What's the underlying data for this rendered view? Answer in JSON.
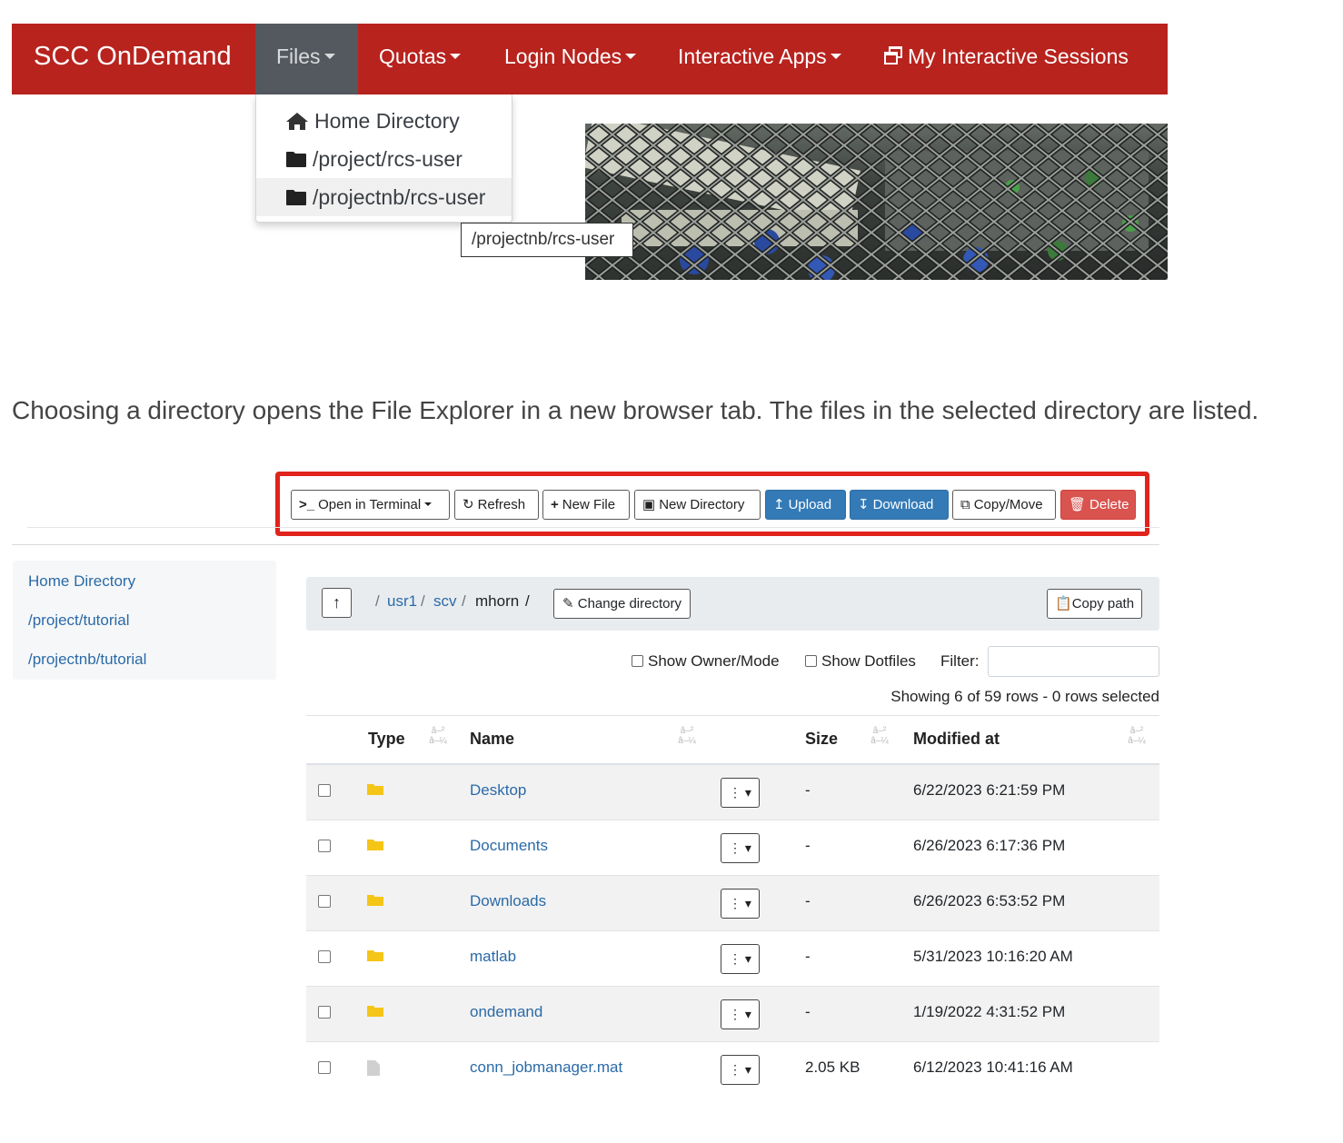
{
  "navbar": {
    "brand": "SCC OnDemand",
    "items": [
      {
        "label": "Files",
        "active": true
      },
      {
        "label": "Quotas"
      },
      {
        "label": "Login Nodes"
      },
      {
        "label": "Interactive Apps"
      },
      {
        "label": "My Interactive Sessions"
      }
    ],
    "files_menu": [
      {
        "label": "Home Directory",
        "icon": "home-icon"
      },
      {
        "label": "/project/rcs-user",
        "icon": "folder-icon"
      },
      {
        "label": "/projectnb/rcs-user",
        "icon": "folder-icon"
      }
    ],
    "tooltip": "/projectnb/rcs-user",
    "colors": {
      "bar": "#b8231e",
      "active": "#54595f"
    }
  },
  "caption": "Choosing a directory opens the File Explorer in a new browser tab. The files in the selected directory are listed.",
  "toolbar": {
    "open_terminal": "Open in Terminal",
    "refresh": "Refresh",
    "new_file": "New File",
    "new_directory": "New Directory",
    "upload": "Upload",
    "download": "Download",
    "copy_move": "Copy/Move",
    "delete": "Delete"
  },
  "favorites": [
    "Home Directory",
    "/project/tutorial",
    "/projectnb/tutorial"
  ],
  "path": {
    "segments": [
      "/",
      "usr1",
      "/",
      "scv",
      "/",
      "mhorn",
      "/"
    ],
    "change_directory": "Change directory",
    "copy_path": "Copy path"
  },
  "options": {
    "show_owner_mode": "Show Owner/Mode",
    "show_dotfiles": "Show Dotfiles",
    "filter_label": "Filter:",
    "row_info": "Showing 6 of 59 rows - 0 rows selected"
  },
  "table": {
    "headers": {
      "type": "Type",
      "name": "Name",
      "size": "Size",
      "modified": "Modified at"
    },
    "sort_glyph_top": "â–²",
    "sort_glyph_bottom": "â–¼",
    "rows": [
      {
        "type": "folder",
        "name": "Desktop",
        "size": "-",
        "modified": "6/22/2023 6:21:59 PM"
      },
      {
        "type": "folder",
        "name": "Documents",
        "size": "-",
        "modified": "6/26/2023 6:17:36 PM"
      },
      {
        "type": "folder",
        "name": "Downloads",
        "size": "-",
        "modified": "6/26/2023 6:53:52 PM"
      },
      {
        "type": "folder",
        "name": "matlab",
        "size": "-",
        "modified": "5/31/2023 10:16:20 AM"
      },
      {
        "type": "folder",
        "name": "ondemand",
        "size": "-",
        "modified": "1/19/2022 4:31:52 PM"
      },
      {
        "type": "file",
        "name": "conn_jobmanager.mat",
        "size": "2.05 KB",
        "modified": "6/12/2023 10:41:16 AM"
      }
    ]
  }
}
